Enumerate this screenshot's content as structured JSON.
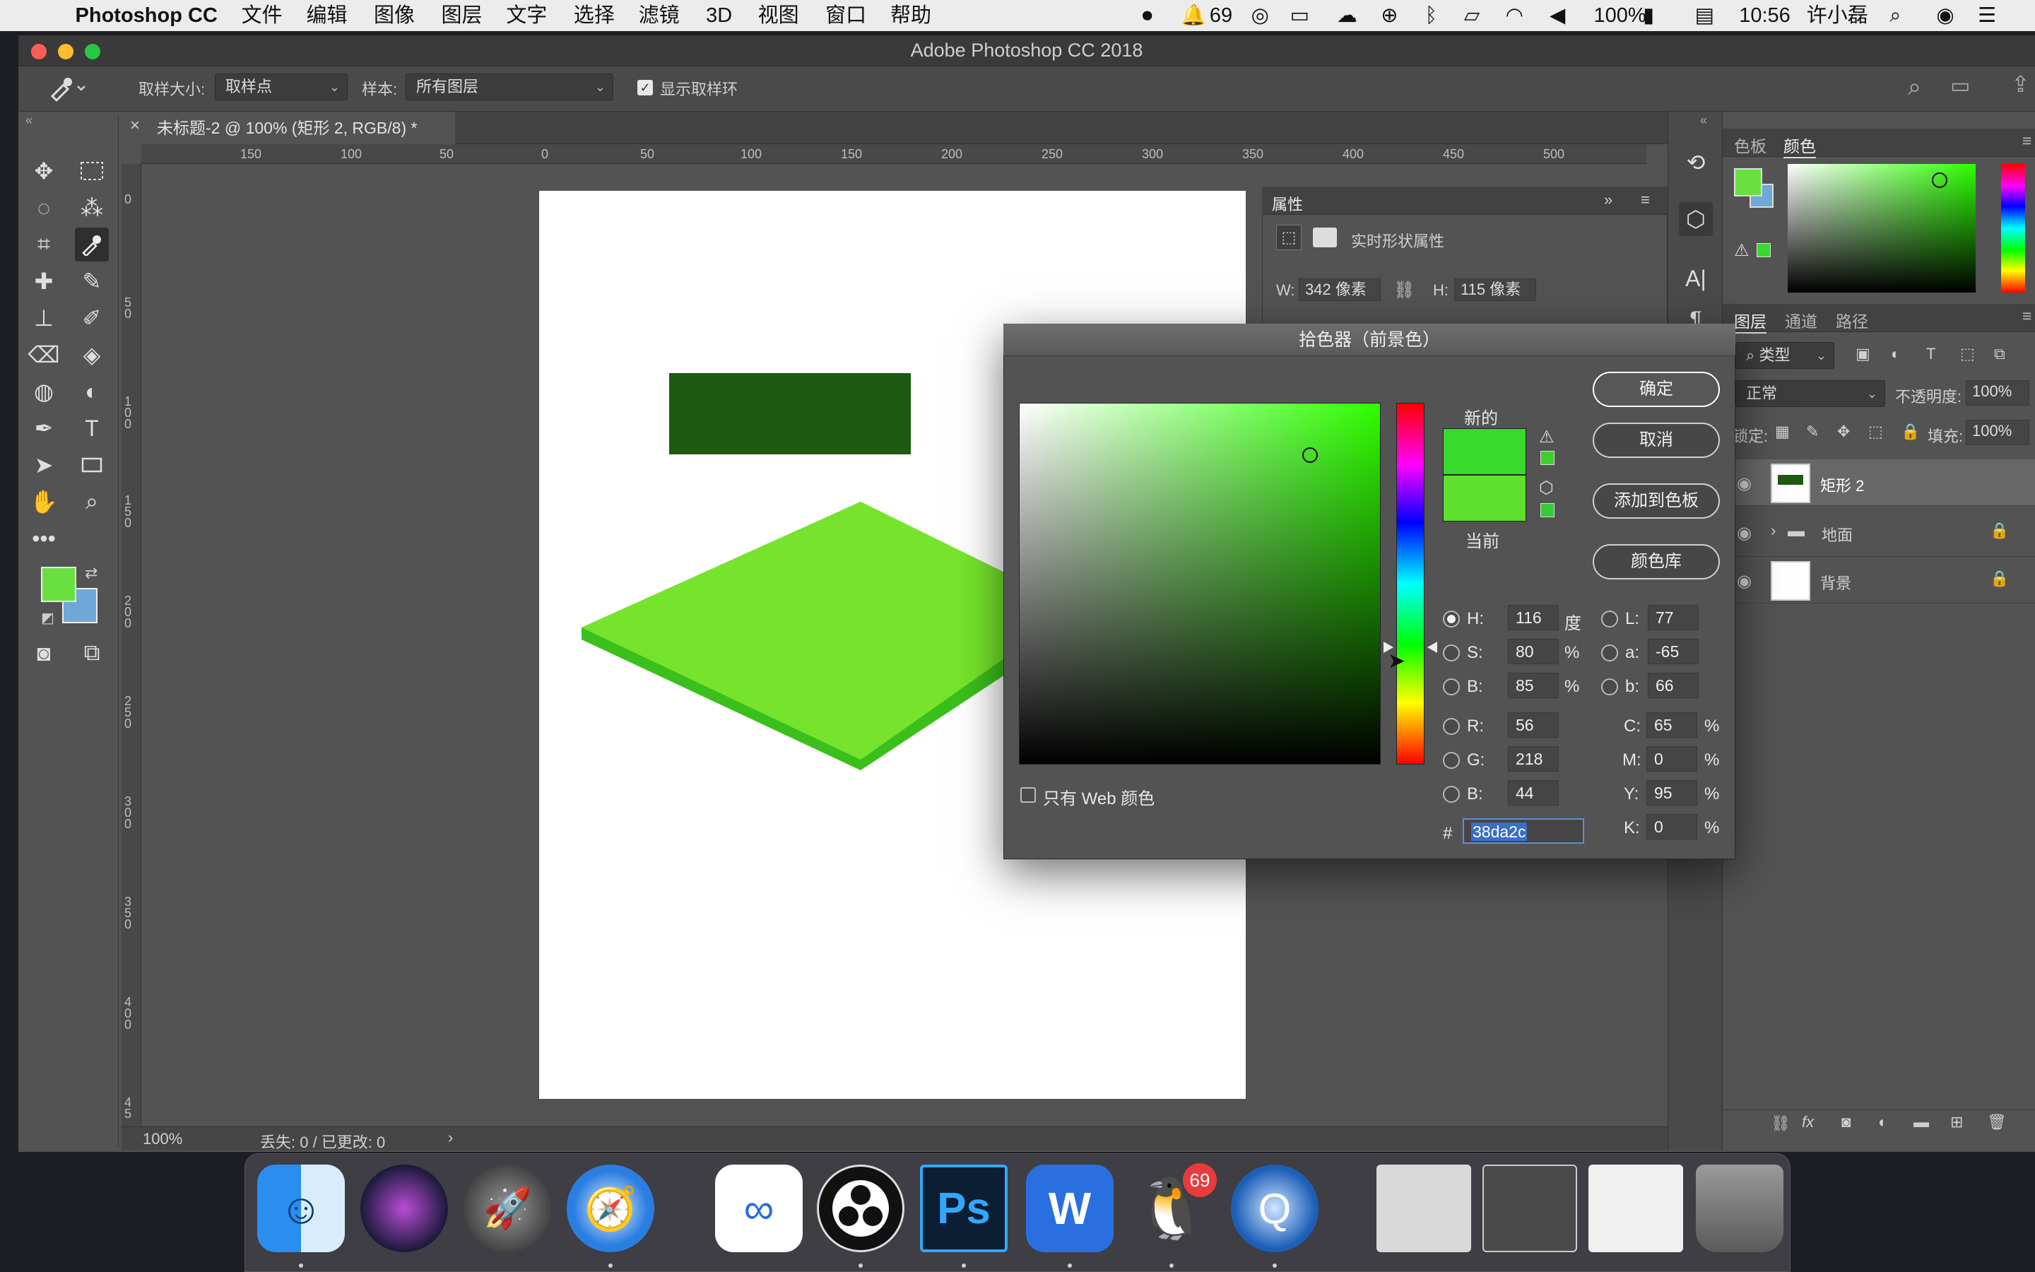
{
  "menubar": {
    "app": "Photoshop CC",
    "menus": [
      "文件",
      "编辑",
      "图像",
      "图层",
      "文字",
      "选择",
      "滤镜",
      "3D",
      "视图",
      "窗口",
      "帮助"
    ],
    "notification_count": "69",
    "battery": "100%",
    "time": "10:56",
    "user": "许小磊"
  },
  "window": {
    "title": "Adobe Photoshop CC 2018"
  },
  "options_bar": {
    "sample_size_label": "取样大小:",
    "sample_size_value": "取样点",
    "sample_label": "样本:",
    "sample_value": "所有图层",
    "show_ring_label": "显示取样环"
  },
  "document": {
    "tab_title": "未标题-2 @ 100% (矩形 2, RGB/8) *",
    "zoom": "100%",
    "status": "丢失: 0 / 已更改: 0",
    "ruler_h": [
      "150",
      "100",
      "50",
      "0",
      "50",
      "100",
      "150",
      "200",
      "250",
      "300",
      "350",
      "400",
      "450",
      "500"
    ],
    "ruler_v": [
      "0",
      "5 0",
      "1 0 0",
      "1 5 0",
      "2 0 0",
      "2 5 0",
      "3 0 0",
      "3 5 0",
      "4 0 0",
      "4 5"
    ]
  },
  "properties": {
    "title": "属性",
    "subtitle": "实时形状属性",
    "w_label": "W:",
    "w_value": "342 像素",
    "h_label": "H:",
    "h_value": "115 像素"
  },
  "color_panel": {
    "tabs": [
      "色板",
      "颜色"
    ],
    "active_tab": "颜色"
  },
  "layers_panel": {
    "tabs": [
      "图层",
      "通道",
      "路径"
    ],
    "kind_filter": "类型",
    "blend_mode": "正常",
    "opacity_label": "不透明度:",
    "opacity_value": "100%",
    "lock_label": "锁定:",
    "fill_label": "填充:",
    "fill_value": "100%",
    "layers": [
      {
        "name": "矩形 2"
      },
      {
        "name": "地面"
      },
      {
        "name": "背景"
      }
    ]
  },
  "color_picker": {
    "title": "拾色器（前景色）",
    "new_label": "新的",
    "current_label": "当前",
    "buttons": {
      "ok": "确定",
      "cancel": "取消",
      "add_swatch": "添加到色板",
      "libraries": "颜色库"
    },
    "web_only_label": "只有 Web 颜色",
    "fields": {
      "H": "116",
      "S": "80",
      "B_hsb": "85",
      "R": "56",
      "G": "218",
      "B_rgb": "44",
      "L": "77",
      "a": "-65",
      "b": "66",
      "C": "65",
      "M": "0",
      "Y": "95",
      "K": "0",
      "hex": "38da2c"
    },
    "field_labels": {
      "H": "H:",
      "S": "S:",
      "B_hsb": "B:",
      "R": "R:",
      "G": "G:",
      "B_rgb": "B:",
      "L": "L:",
      "a": "a:",
      "b": "b:",
      "C": "C:",
      "M": "M:",
      "Y": "Y:",
      "K": "K:"
    },
    "units": {
      "degree": "度",
      "percent": "%",
      "hash": "#"
    }
  },
  "dock": {
    "qq_badge": "69",
    "ps_label": "Ps"
  },
  "colors": {
    "new_color": "#38da2c",
    "current_color": "#5ee02e",
    "foreground": "#6ae040",
    "background": "#6ea7d9",
    "rect_dark": "#1e5a12",
    "platform_top": "#76e42c",
    "platform_side": "#3bbf1c"
  }
}
